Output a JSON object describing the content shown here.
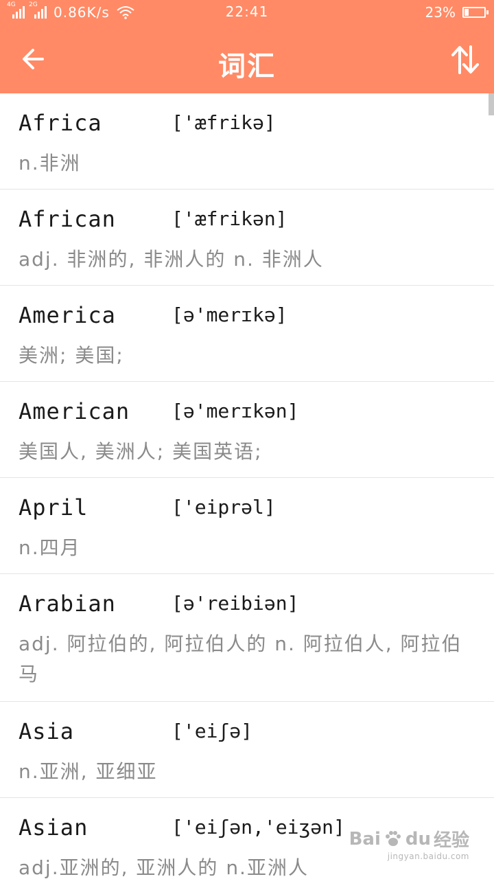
{
  "status_bar": {
    "net1": "4G",
    "net2": "2G",
    "speed": "0.86K/s",
    "time": "22:41",
    "battery_text": "23%",
    "battery_level": 0.23
  },
  "appbar": {
    "title": "词汇",
    "back_icon": "arrow-left-icon",
    "sort_icon": "sort-arrows-icon",
    "color": "#FF8A65"
  },
  "words": [
    {
      "word": "Africa",
      "phonetic": "['æfrikə]",
      "meaning": "n.非洲"
    },
    {
      "word": "African",
      "phonetic": "['æfrikən]",
      "meaning": "adj. 非洲的, 非洲人的 n. 非洲人"
    },
    {
      "word": "America",
      "phonetic": "[ə'merɪkə]",
      "meaning": "美洲; 美国;"
    },
    {
      "word": "American",
      "phonetic": "[ə'merɪkən]",
      "meaning": "美国人, 美洲人; 美国英语;"
    },
    {
      "word": "April",
      "phonetic": "['eiprəl]",
      "meaning": "n.四月"
    },
    {
      "word": "Arabian",
      "phonetic": "[ə'reibiən]",
      "meaning": "adj. 阿拉伯的, 阿拉伯人的 n. 阿拉伯人, 阿拉伯马"
    },
    {
      "word": "Asia",
      "phonetic": "['eiʃə]",
      "meaning": "n.亚洲, 亚细亚"
    },
    {
      "word": "Asian",
      "phonetic": "['eiʃən,'eiʒən]",
      "meaning": "adj.亚洲的, 亚洲人的 n.亚洲人"
    }
  ],
  "watermark": {
    "brand": "Bai",
    "brand2": "du",
    "label": "经验",
    "url": "jingyan.baidu.com"
  }
}
